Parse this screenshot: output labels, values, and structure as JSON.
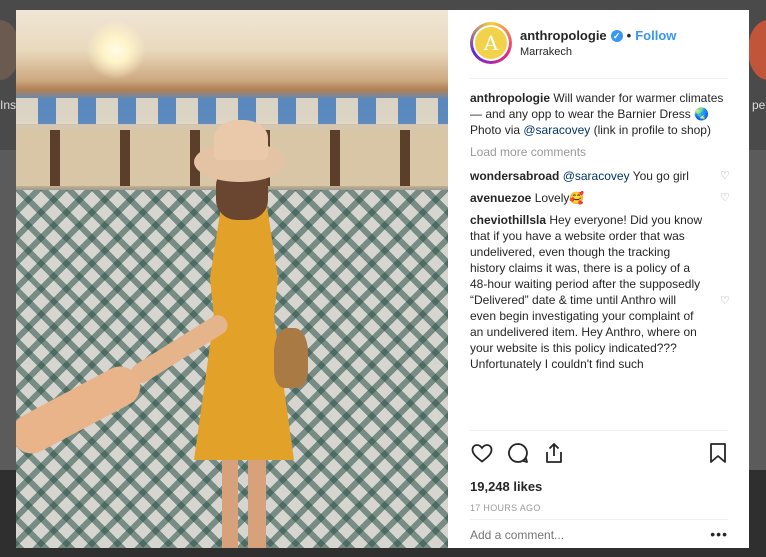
{
  "background": {
    "left_label": "Ins",
    "right_label": "pe"
  },
  "post": {
    "avatar_letter": "A",
    "username": "anthropologie",
    "verified_icon": "verified-badge-icon",
    "follow_label": "Follow",
    "location": "Marrakech"
  },
  "caption": {
    "username": "anthropologie",
    "text_before": " Will wander for warmer climates — and any opp to wear the Barnier Dress 🌏 Photo via ",
    "mention": "@saracovey",
    "text_after": " (link in profile to shop)"
  },
  "load_more": "Load more comments",
  "comments": [
    {
      "user": "wondersabroad",
      "mention": "@saracovey",
      "text": " You go girl"
    },
    {
      "user": "avenuezoe",
      "mention": "",
      "text": " Lovely🥰"
    },
    {
      "user": "cheviothillsla",
      "mention": "",
      "text": " Hey everyone! Did you know that if you have a website order that was undelivered, even though the tracking history claims it was, there is a policy of a 48-hour waiting period after the supposedly “Delivered” date & time until Anthro will even begin investigating your complaint of an undelivered item. Hey Anthro, where on your website is this policy indicated??? Unfortunately I couldn't find such"
    }
  ],
  "likes": "19,248 likes",
  "time": "17 HOURS AGO",
  "add_comment_placeholder": "Add a comment...",
  "more_options": "•••",
  "colors": {
    "accent": "#3897f0",
    "text": "#262626",
    "muted": "#999999"
  }
}
